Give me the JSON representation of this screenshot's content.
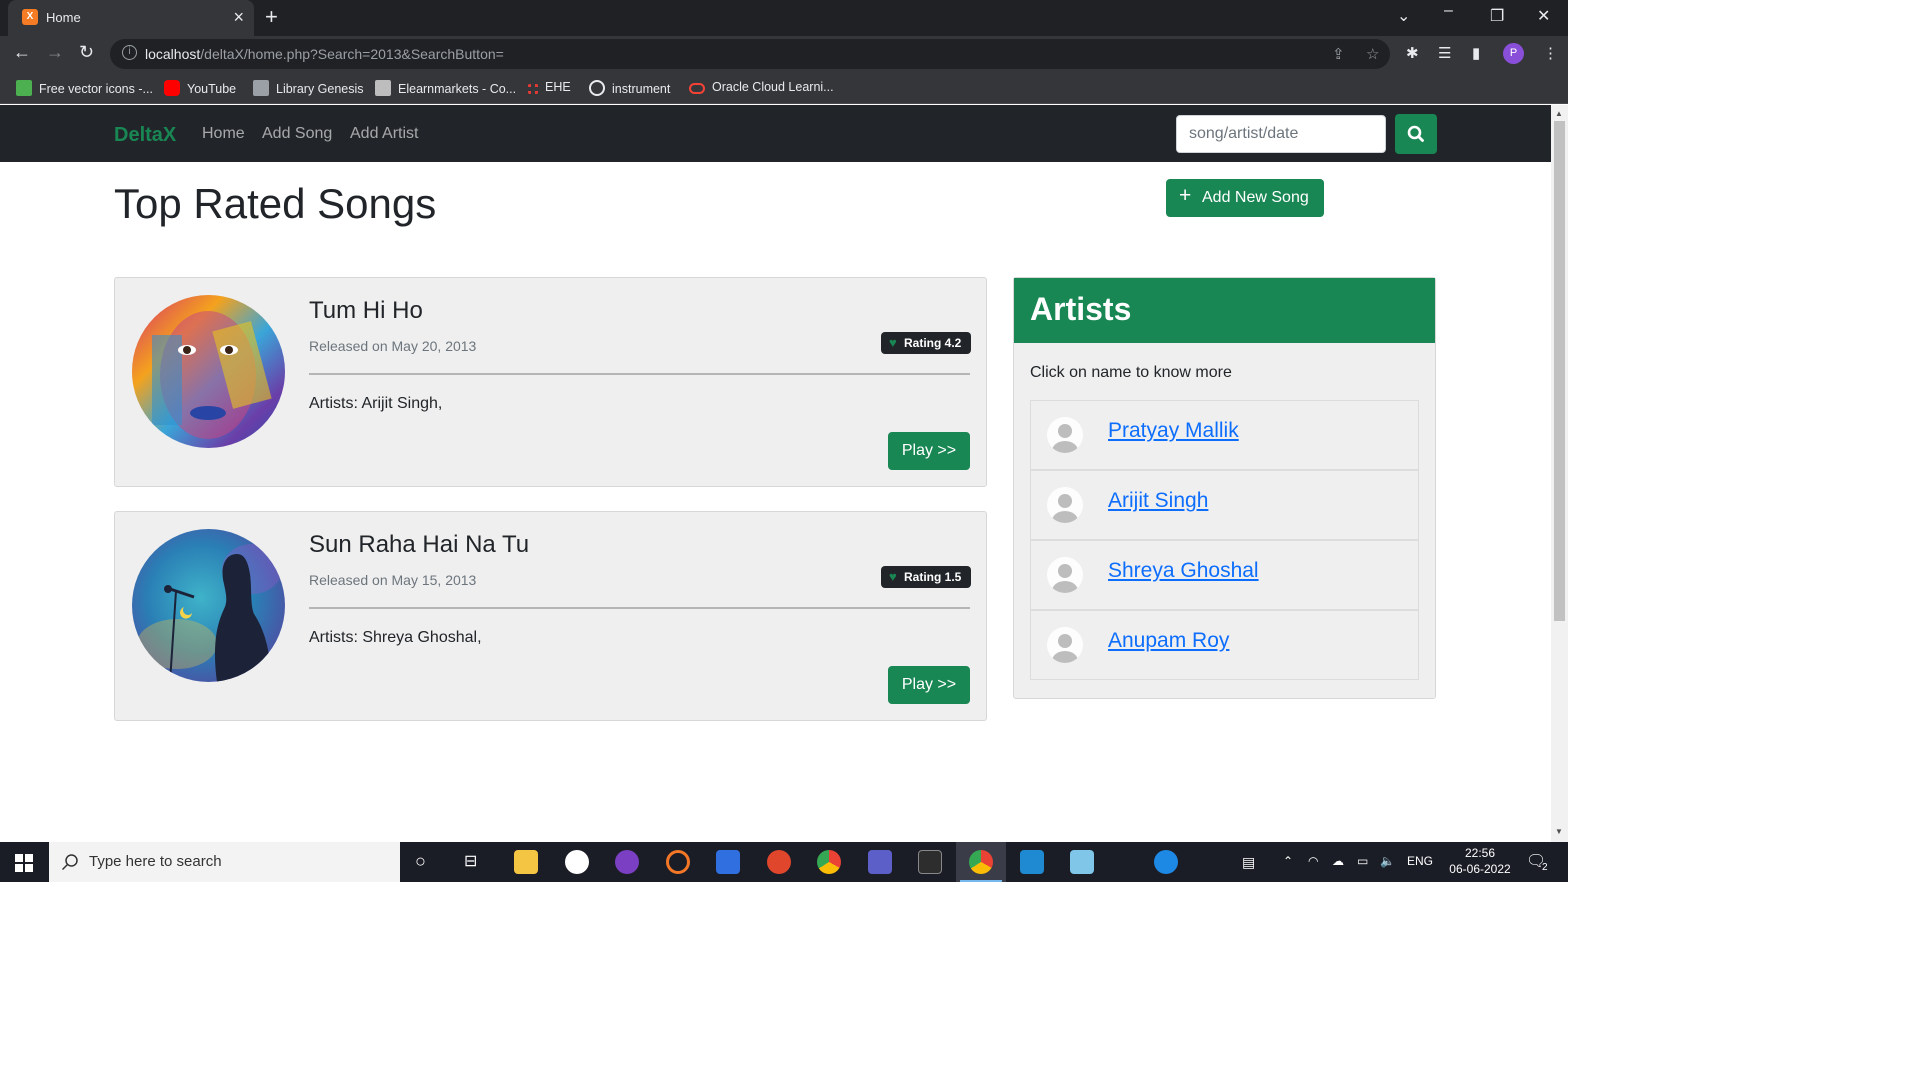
{
  "browser": {
    "tab_title": "Home",
    "tab_favicon_letter": "X",
    "url_host": "localhost",
    "url_rest": "/deltaX/home.php?Search=2013&SearchButton=",
    "profile_initial": "P",
    "bookmarks": [
      {
        "label": "Free vector icons -...",
        "icon": "flaticon-icon",
        "color": "#4caf50"
      },
      {
        "label": "YouTube",
        "icon": "youtube-icon",
        "color": "#ff0000"
      },
      {
        "label": "Library Genesis",
        "icon": "book-icon",
        "color": "#9aa0a6"
      },
      {
        "label": "Elearnmarkets - Co...",
        "icon": "chart-icon",
        "color": "#9aa0a6"
      },
      {
        "label": "EHE",
        "icon": "ehe-icon",
        "color": "#e53935"
      },
      {
        "label": "instrument",
        "icon": "wordpress-icon",
        "color": "#e8eaed"
      },
      {
        "label": "Oracle Cloud Learni...",
        "icon": "oracle-icon",
        "color": "#f44336"
      }
    ]
  },
  "nav": {
    "brand": "DeltaX",
    "links": [
      "Home",
      "Add Song",
      "Add Artist"
    ],
    "search_placeholder": "song/artist/date"
  },
  "main": {
    "title": "Top Rated Songs",
    "add_song_label": "Add New Song",
    "songs": [
      {
        "title": "Tum Hi Ho",
        "released": "Released on May 20, 2013",
        "rating": "Rating 4.2",
        "artists": "Artists: Arijit Singh,",
        "play": "Play >>"
      },
      {
        "title": "Sun Raha Hai Na Tu",
        "released": "Released on May 15, 2013",
        "rating": "Rating 1.5",
        "artists": "Artists: Shreya Ghoshal,",
        "play": "Play >>"
      }
    ]
  },
  "artists_panel": {
    "title": "Artists",
    "subtitle": "Click on name to know more",
    "artists": [
      "Pratyay Mallik",
      "Arijit Singh",
      "Shreya Ghoshal",
      "Anupam Roy"
    ]
  },
  "taskbar": {
    "search_placeholder": "Type here to search",
    "language": "ENG",
    "time": "22:56",
    "date": "06-06-2022",
    "notification_count": "2"
  },
  "colors": {
    "accent": "#198754",
    "navbar": "#212529",
    "link": "#0d6efd"
  }
}
